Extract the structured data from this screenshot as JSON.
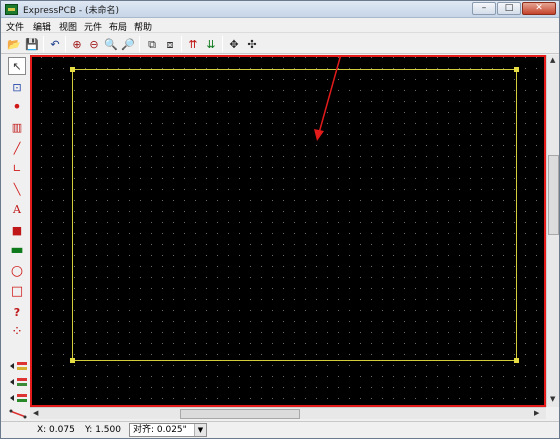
{
  "window": {
    "title": "ExpressPCB - (未命名)",
    "minimize": "–",
    "maximize": "□",
    "close": "✕"
  },
  "menu": [
    "文件",
    "编辑",
    "视图",
    "元件",
    "布局",
    "帮助"
  ],
  "toolbar": {
    "tools": [
      {
        "name": "open-folder-icon",
        "glyph": "📂"
      },
      {
        "name": "save-icon",
        "glyph": "💾"
      },
      {
        "name": "undo-icon",
        "glyph": "↶"
      },
      {
        "name": "zoom-in-icon",
        "glyph": "⊕"
      },
      {
        "name": "zoom-out-icon",
        "glyph": "⊖"
      },
      {
        "name": "zoom-window-icon",
        "glyph": "🔍"
      },
      {
        "name": "zoom-fit-icon",
        "glyph": "🔎"
      },
      {
        "name": "layer-3d-icon",
        "glyph": "⧉"
      },
      {
        "name": "layer-switch-icon",
        "glyph": "⧈"
      },
      {
        "name": "top-layer-icon",
        "glyph": "⇈"
      },
      {
        "name": "bottom-layer-icon",
        "glyph": "⇊"
      },
      {
        "name": "pan-icon",
        "glyph": "✥"
      },
      {
        "name": "move-icon",
        "glyph": "✣"
      }
    ]
  },
  "palette": [
    {
      "name": "select-arrow-icon",
      "glyph": "↖",
      "active": true
    },
    {
      "name": "lasso-select-icon",
      "glyph": "⊡"
    },
    {
      "name": "place-pad-icon",
      "glyph": "•"
    },
    {
      "name": "place-component-icon",
      "glyph": "▥"
    },
    {
      "name": "trace-icon",
      "glyph": "╱"
    },
    {
      "name": "angle-trace-icon",
      "glyph": "∟"
    },
    {
      "name": "diagonal-trace-icon",
      "glyph": "╲"
    },
    {
      "name": "text-icon",
      "glyph": "A"
    },
    {
      "name": "layer-fill-icon",
      "glyph": "■"
    },
    {
      "name": "ground-plane-icon",
      "glyph": "▬"
    },
    {
      "name": "circle-icon",
      "glyph": "○"
    },
    {
      "name": "rectangle-icon",
      "glyph": "□"
    },
    {
      "name": "help-pad-icon",
      "glyph": "?"
    },
    {
      "name": "netlist-icon",
      "glyph": "⁘"
    }
  ],
  "status": {
    "x": "X: 0.075",
    "y": "Y: 1.500",
    "snap": "对齐:  0.025\""
  },
  "colors": {
    "board_outline": "#d4cd3b",
    "frame": "#e31b1b",
    "canvas": "#000000"
  }
}
